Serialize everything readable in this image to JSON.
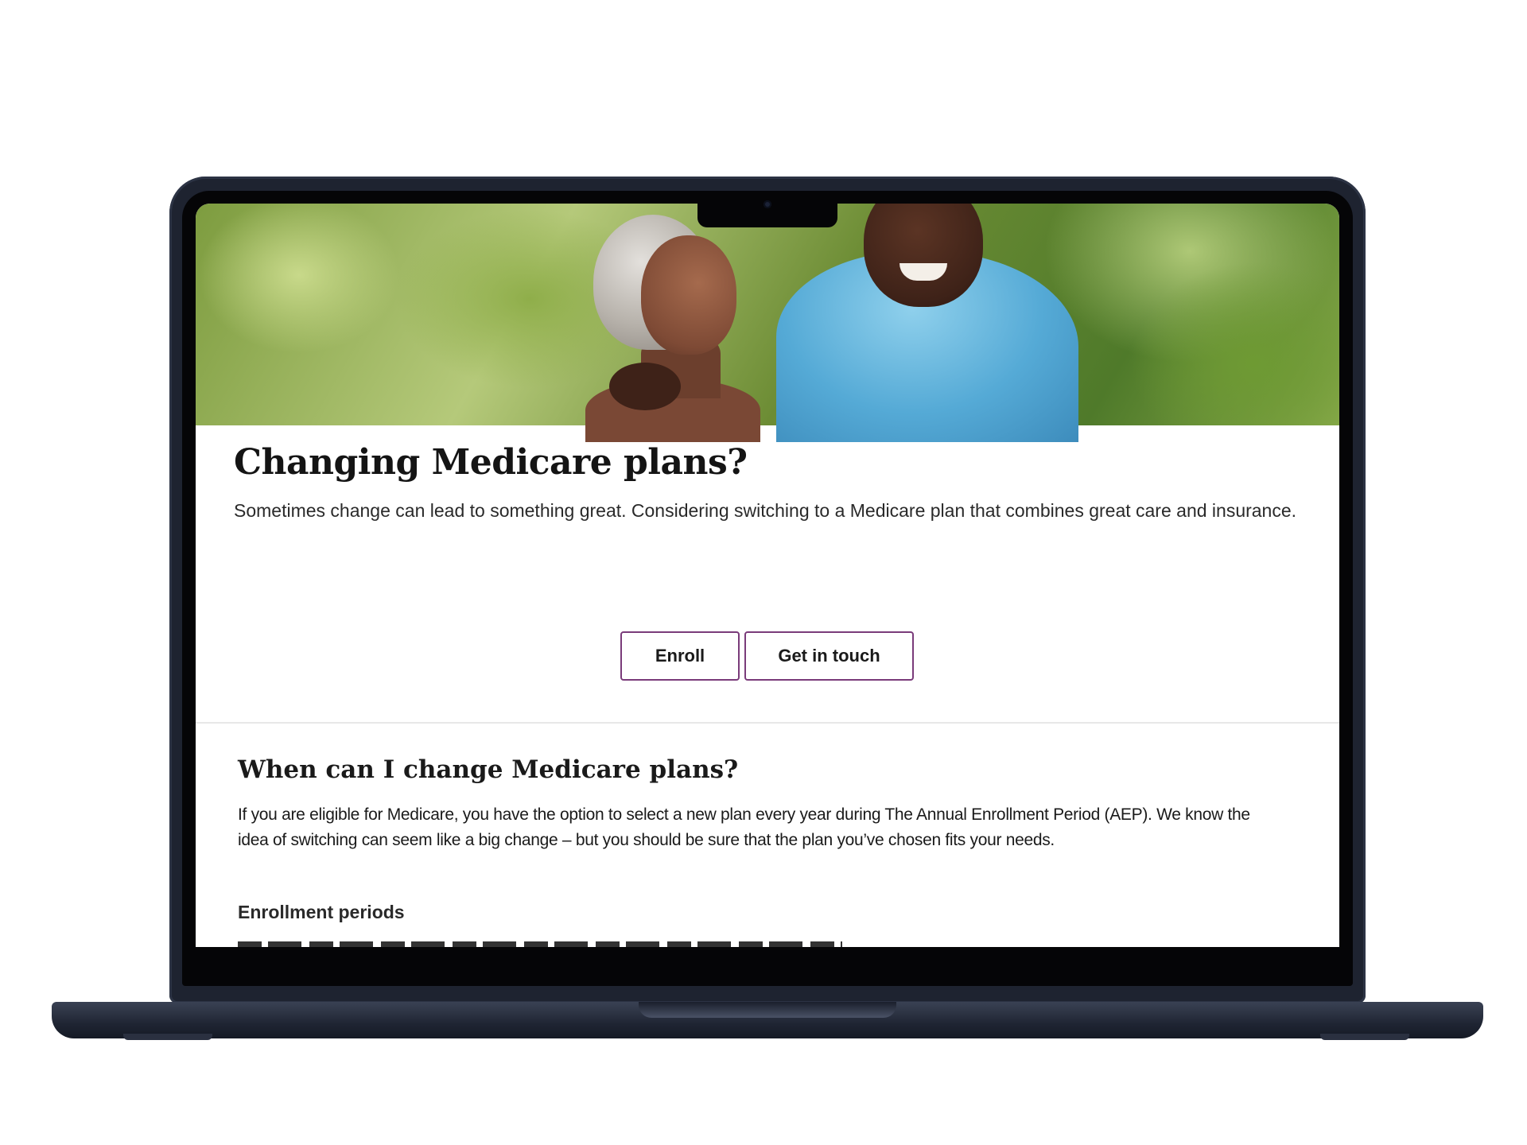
{
  "page": {
    "title": "Changing Medicare plans?",
    "description": "Sometimes change can lead to something great. Considering switching to a Medicare plan that combines great care and insurance."
  },
  "buttons": {
    "enroll_label": "Enroll",
    "contact_label": "Get in touch"
  },
  "section": {
    "title": "When can I change Medicare plans?",
    "body": "If you are eligible for Medicare, you have the option to select a new plan every year during The Annual Enrollment Period (AEP). We know the idea of switching can seem like a big change – but you should be sure that the plan you’ve chosen fits your needs.",
    "subheading": "Enrollment periods"
  },
  "colors": {
    "button_border": "#7a3b7a",
    "laptop_body": "#1e2330"
  },
  "icons": {
    "camera": "camera-icon"
  }
}
